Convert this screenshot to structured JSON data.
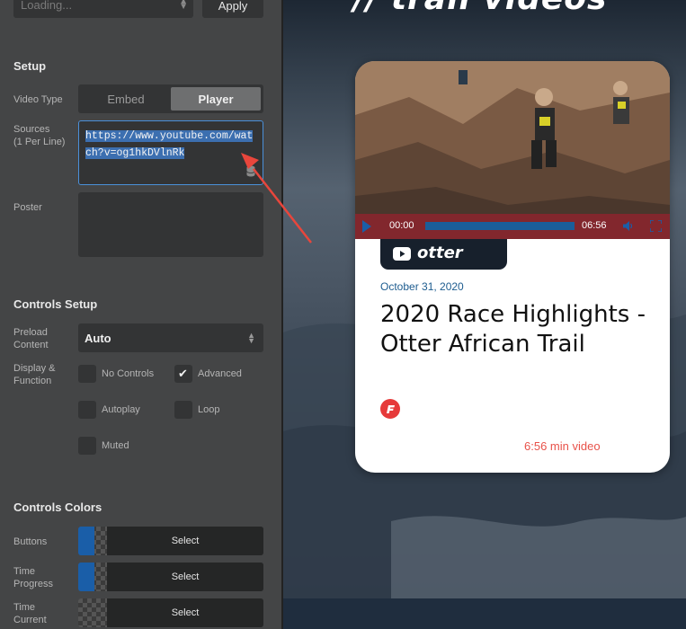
{
  "toolbar": {
    "loading_text": "Loading...",
    "apply_label": "Apply"
  },
  "setup": {
    "section_title": "Setup",
    "video_type_label": "Video Type",
    "video_type_options": [
      "Embed",
      "Player"
    ],
    "video_type_selected": "Player",
    "sources_label_line1": "Sources",
    "sources_label_line2": "(1 Per Line)",
    "sources_value": "https://www.youtube.com/watch?v=og1hkDVlnRk",
    "poster_label": "Poster",
    "poster_value": ""
  },
  "controls_setup": {
    "section_title": "Controls Setup",
    "preload_label_line1": "Preload",
    "preload_label_line2": "Content",
    "preload_value": "Auto",
    "display_label_line1": "Display &",
    "display_label_line2": "Function",
    "checkboxes": [
      {
        "label": "No Controls",
        "checked": false
      },
      {
        "label": "Advanced",
        "checked": true
      },
      {
        "label": "Autoplay",
        "checked": false
      },
      {
        "label": "Loop",
        "checked": false
      },
      {
        "label": "Muted",
        "checked": false
      }
    ]
  },
  "controls_colors": {
    "section_title": "Controls Colors",
    "rows": [
      {
        "label_line1": "Buttons",
        "label_line2": "",
        "button_label": "Select",
        "color": "#1a5ea8"
      },
      {
        "label_line1": "Time",
        "label_line2": "Progress",
        "button_label": "Select",
        "color": "#1a5ea8"
      },
      {
        "label_line1": "Time",
        "label_line2": "Current",
        "button_label": "Select",
        "color": ""
      }
    ]
  },
  "preview": {
    "heading": "// trail videos",
    "video": {
      "current_time": "00:00",
      "duration_time": "06:56"
    },
    "channel_name": "otter",
    "date": "October 31, 2020",
    "title": "2020 Race Highlights - Otter African Trail",
    "duration_text": "6:56 min video"
  },
  "colors": {
    "panel_bg": "#444546",
    "input_bg": "#333435",
    "accent_blue": "#1a5ea8",
    "player_bar": "#96232d",
    "date_blue": "#1d5c8f",
    "duration_red": "#e8524a",
    "annotation_arrow": "#e8463c"
  }
}
